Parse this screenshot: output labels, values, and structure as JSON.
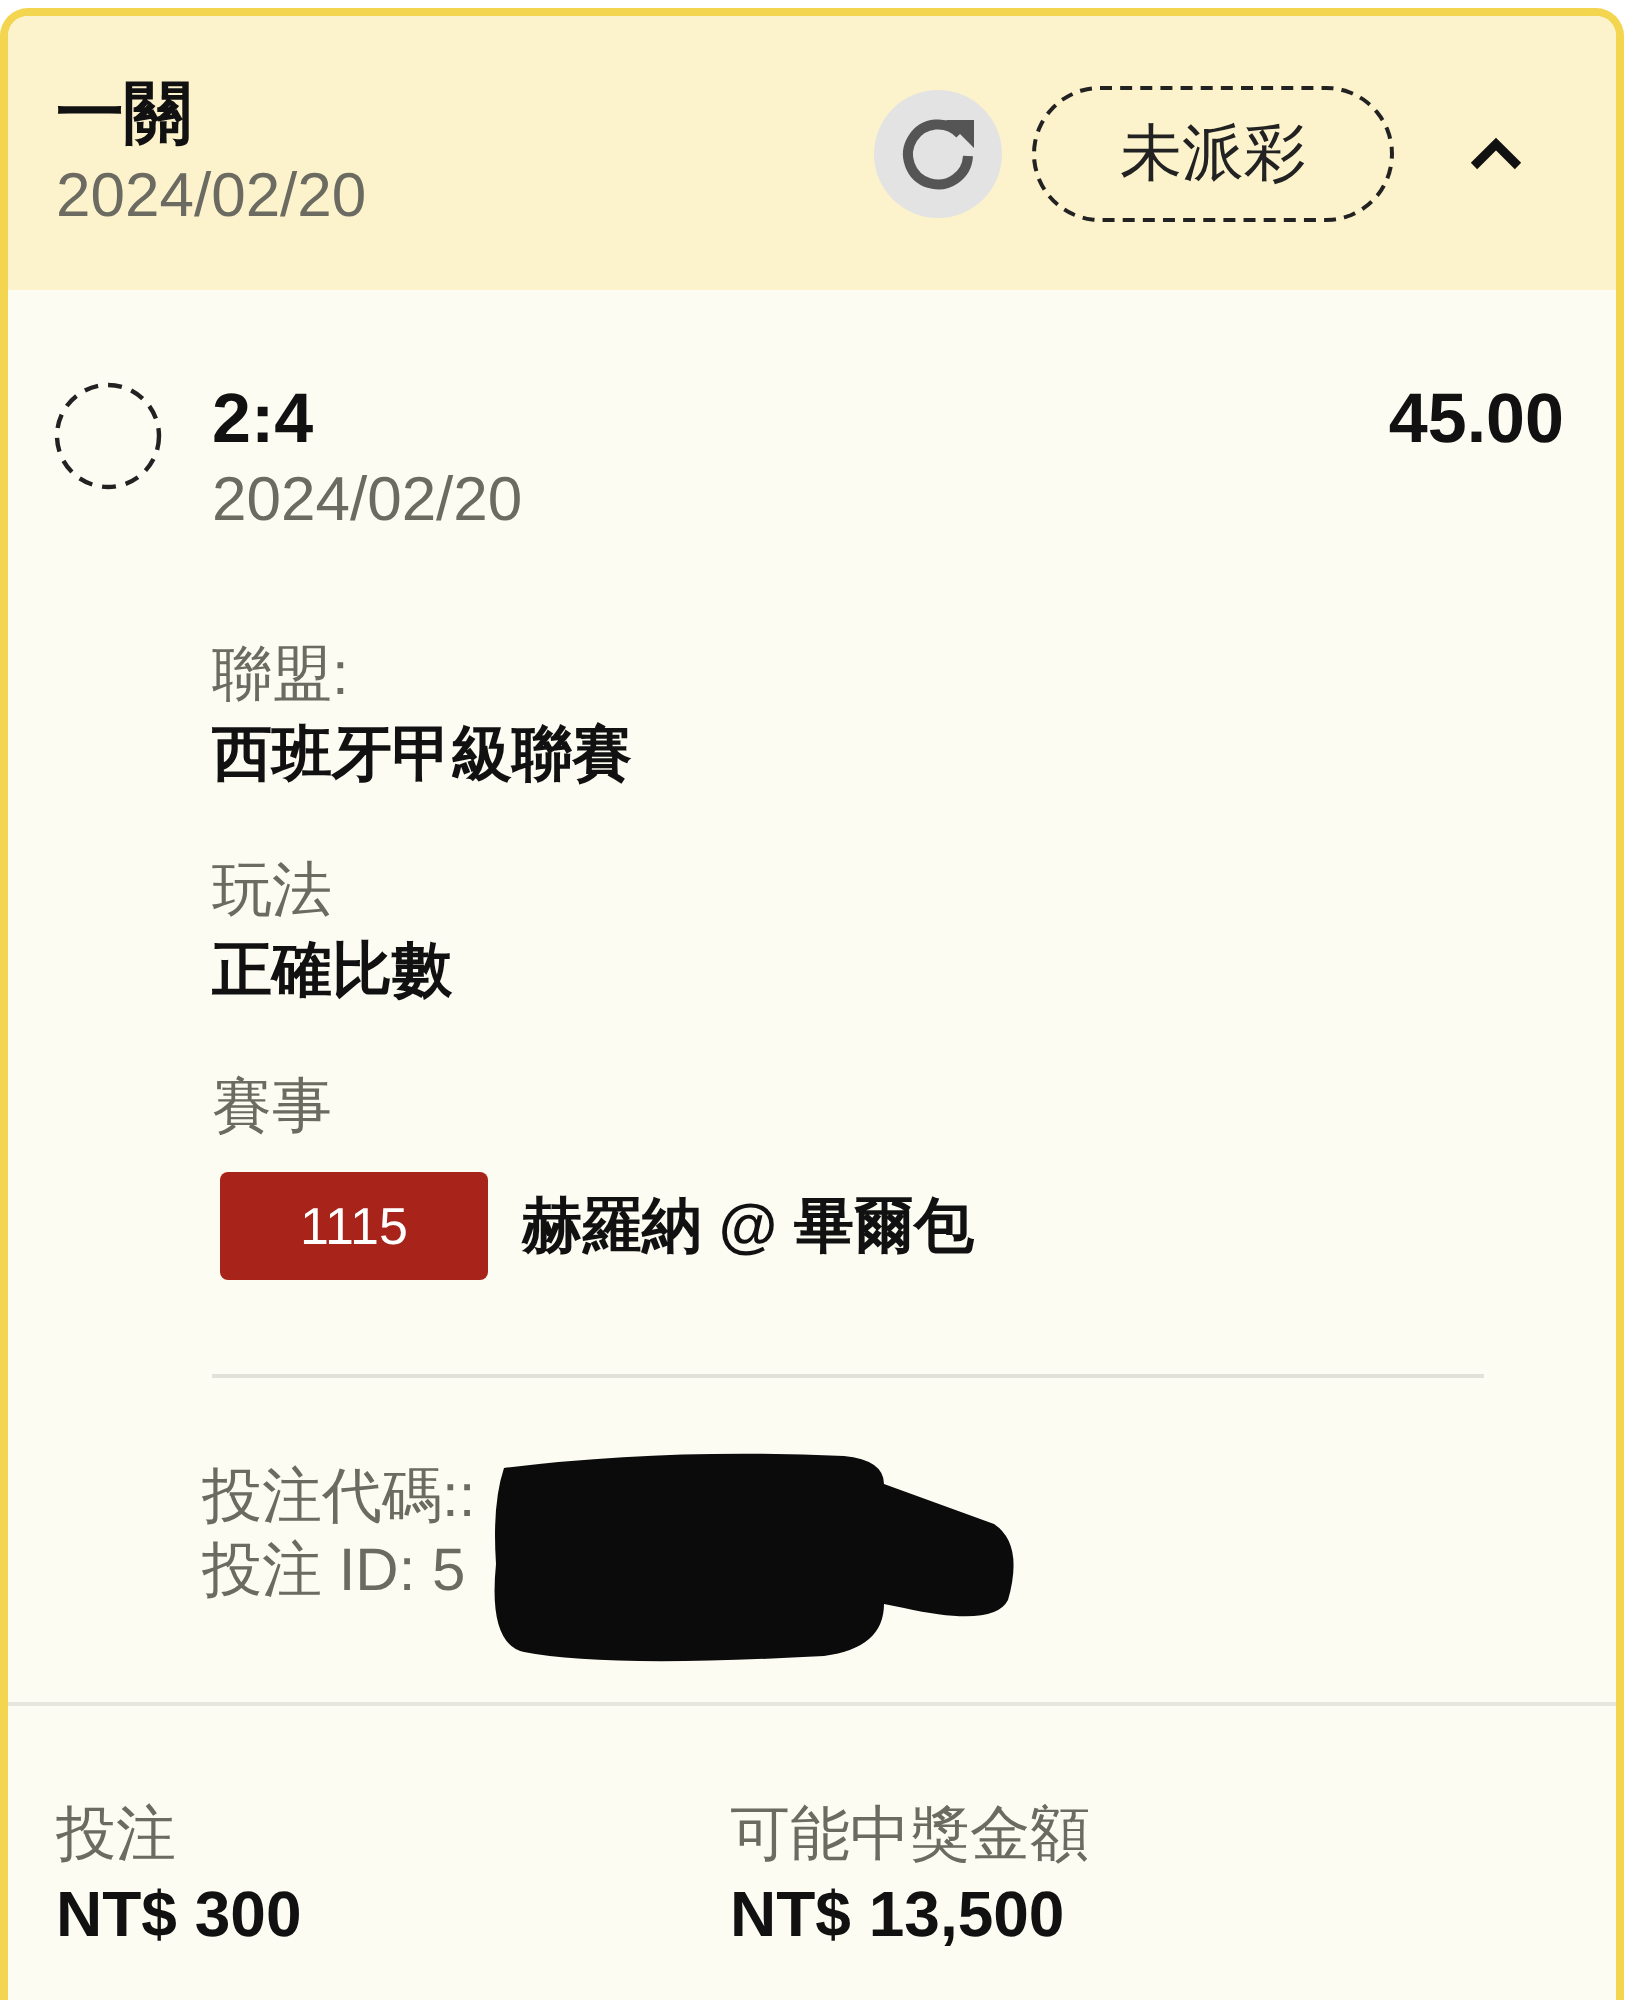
{
  "header": {
    "title": "一關",
    "date": "2024/02/20",
    "status": "未派彩",
    "expanded": true
  },
  "selection": {
    "score": "2:4",
    "odds": "45.00",
    "date": "2024/02/20",
    "fields": [
      {
        "kind": "text",
        "label": "聯盟:",
        "value": "西班牙甲級聯賽"
      },
      {
        "kind": "text",
        "label": "玩法",
        "value": "正確比數"
      },
      {
        "kind": "match",
        "label": "賽事",
        "match_number": "1115",
        "value": "赫羅納 @ 畢爾包"
      }
    ]
  },
  "bet_info": {
    "lines": [
      "投注代碼::",
      "投注 ID: 5"
    ],
    "redacted": true
  },
  "summary": [
    {
      "label": "投注",
      "value": "NT$ 300"
    },
    {
      "label": "可能中獎金額",
      "value": "NT$ 13,500"
    }
  ]
}
